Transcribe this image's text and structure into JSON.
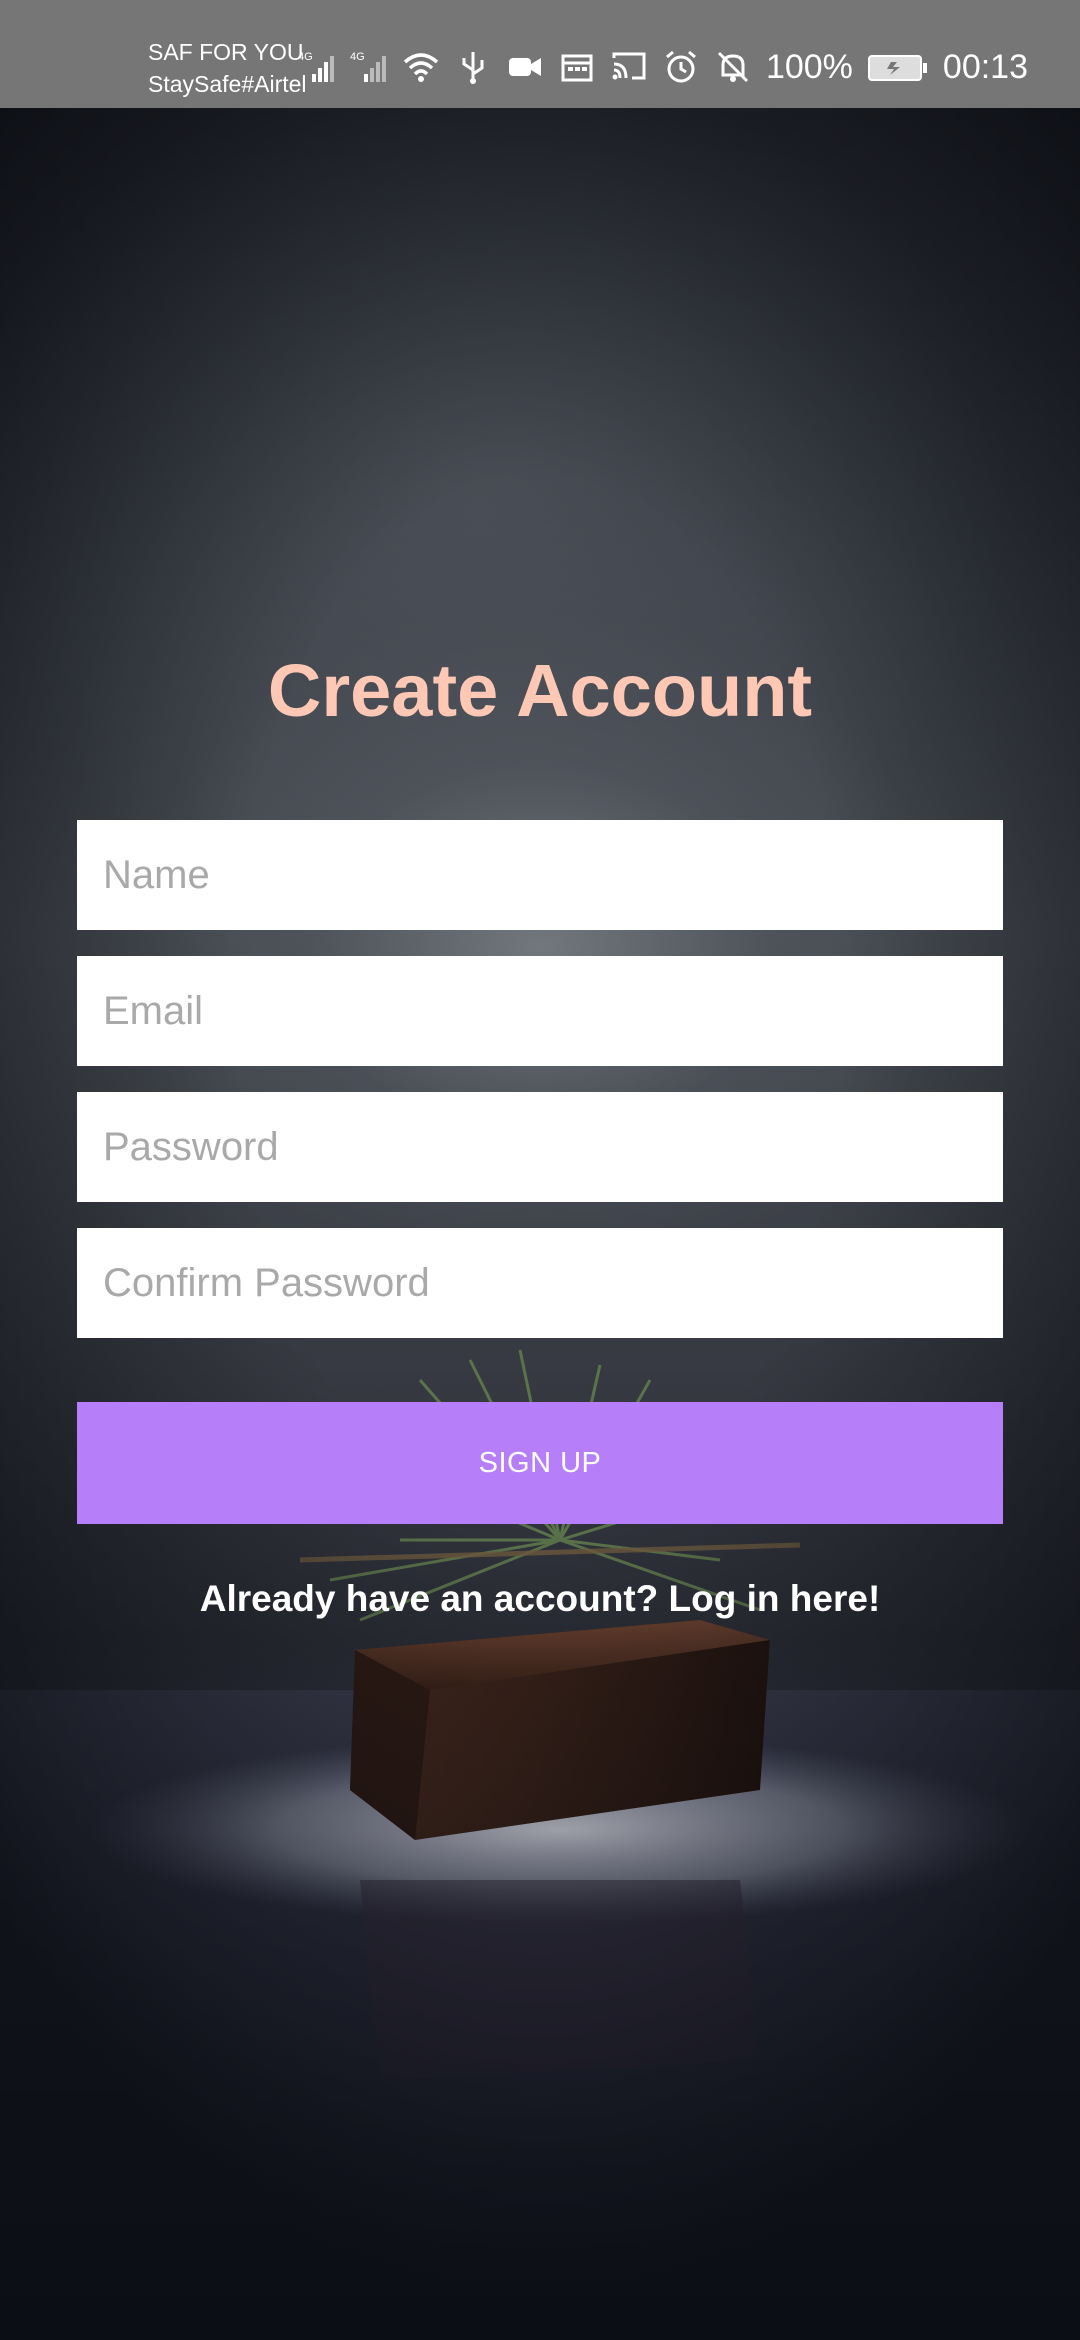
{
  "status_bar": {
    "carrier_line1": "SAF FOR YOU",
    "carrier_line2": "StaySafe#Airtel",
    "icons": [
      "4g-signal-icon",
      "4g-signal-icon",
      "wifi-icon",
      "usb-icon",
      "video-camera-icon",
      "calendar-icon",
      "cast-icon",
      "alarm-icon",
      "bell-off-icon",
      "battery-icon"
    ],
    "battery_percent": "100%",
    "time": "00:13"
  },
  "form": {
    "title": "Create Account",
    "name_placeholder": "Name",
    "email_placeholder": "Email",
    "password_placeholder": "Password",
    "confirm_password_placeholder": "Confirm Password",
    "signup_label": "SIGN UP",
    "login_link": "Already have an account? Log in here!"
  },
  "colors": {
    "title": "#ffc8b4",
    "signup_button": "#b67ef9",
    "status_bar": "#767676"
  }
}
